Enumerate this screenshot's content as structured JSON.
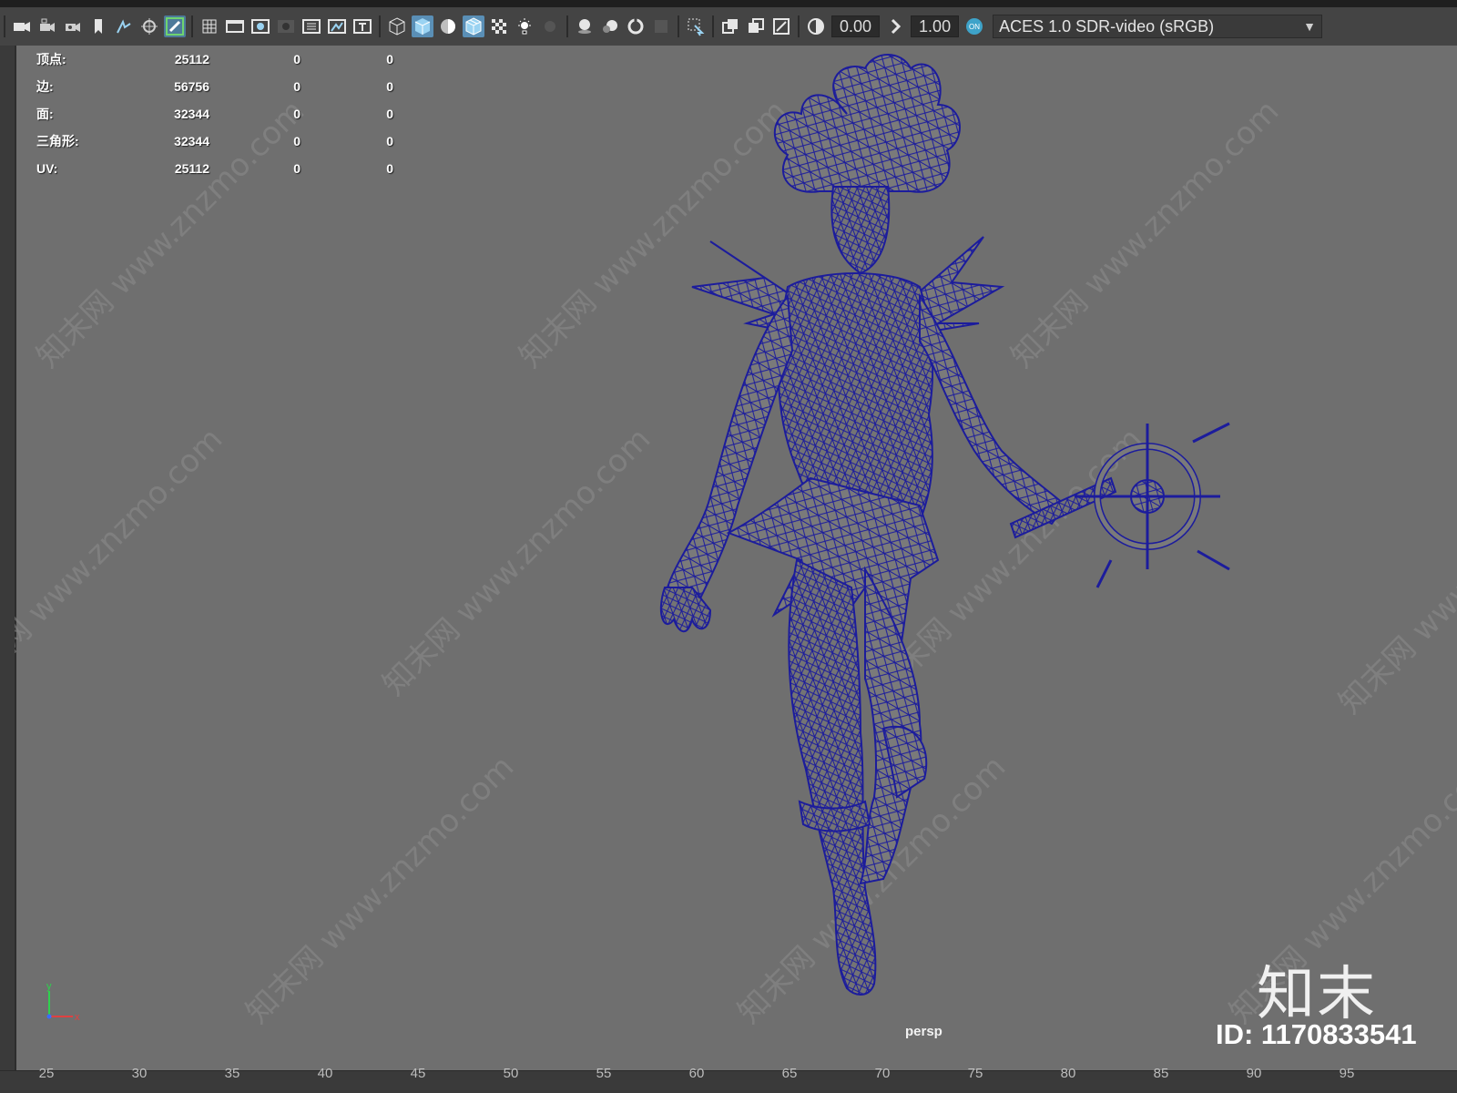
{
  "toolbar": {
    "exposure_value": "0.00",
    "gamma_value": "1.00",
    "color_management_badge": "ON",
    "color_space": "ACES 1.0 SDR-video (sRGB)"
  },
  "hud": {
    "rows": [
      {
        "label": "顶点:",
        "v1": "25112",
        "v2": "0",
        "v3": "0"
      },
      {
        "label": "边:",
        "v1": "56756",
        "v2": "0",
        "v3": "0"
      },
      {
        "label": "面:",
        "v1": "32344",
        "v2": "0",
        "v3": "0"
      },
      {
        "label": "三角形:",
        "v1": "32344",
        "v2": "0",
        "v3": "0"
      },
      {
        "label": "UV:",
        "v1": "25112",
        "v2": "0",
        "v3": "0"
      }
    ]
  },
  "viewport": {
    "camera_label": "persp",
    "axis_y": "y",
    "axis_x": "x"
  },
  "watermark": {
    "text": "知末网 www.znzmo.com",
    "logo": "知末",
    "id": "ID: 1170833541"
  },
  "timeline": {
    "ticks": [
      "25",
      "30",
      "35",
      "40",
      "45",
      "50",
      "55",
      "60",
      "65",
      "70",
      "75",
      "80",
      "85",
      "90",
      "95"
    ]
  },
  "colors": {
    "wireframe": "#1c1c9c",
    "viewport_bg": "#6f6f6f",
    "toolbar_bg": "#444444",
    "accent": "#5a8fb6"
  }
}
